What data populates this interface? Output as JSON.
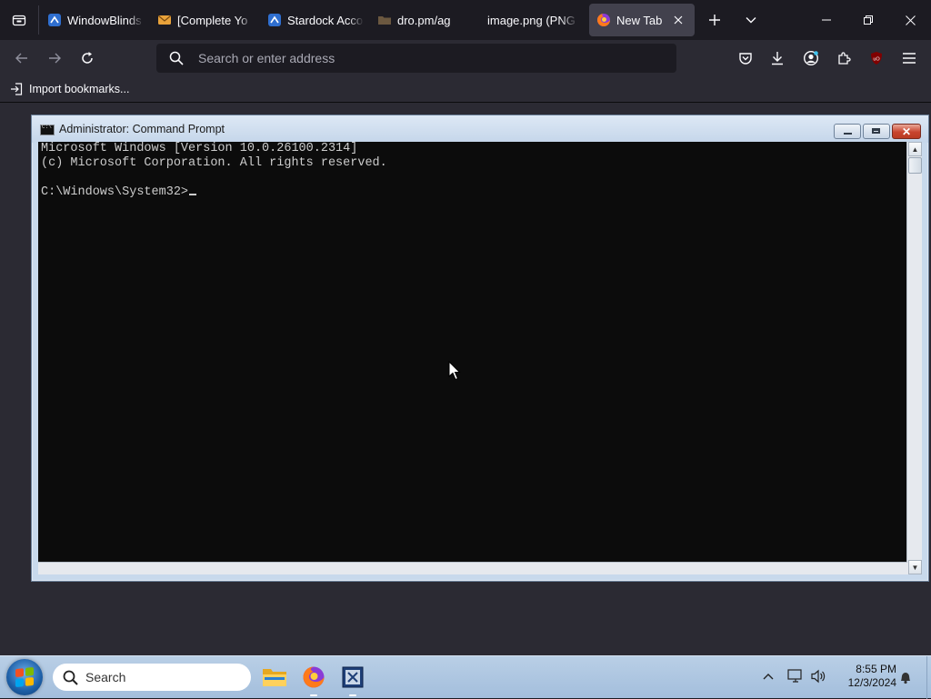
{
  "browser": {
    "tabs": [
      {
        "title": "WindowBlinds",
        "icon": "stardock-icon"
      },
      {
        "title": "[Complete Yo",
        "icon": "mail-icon"
      },
      {
        "title": "Stardock Acco",
        "icon": "stardock-icon"
      },
      {
        "title": "dro.pm/ag",
        "icon": "folder-icon"
      },
      {
        "title": "image.png (PNG I",
        "icon": "none"
      },
      {
        "title": "New Tab",
        "icon": "firefox-icon",
        "active": true
      }
    ],
    "address_bar": {
      "placeholder": "Search or enter address",
      "value": ""
    },
    "bookmarks": [
      {
        "label": "Import bookmarks...",
        "icon": "import-icon"
      }
    ],
    "colors": {
      "frame": "#1c1b22",
      "toolbar": "#2b2a33",
      "active_tab": "#42414d"
    }
  },
  "cmd_window": {
    "title": "Administrator: Command Prompt",
    "lines": [
      "Microsoft Windows [Version 10.0.26100.2314]",
      "(c) Microsoft Corporation. All rights reserved.",
      "",
      "C:\\Windows\\System32>"
    ]
  },
  "taskbar": {
    "search_label": "Search",
    "apps": [
      {
        "name": "File Explorer",
        "icon": "folder-icon"
      },
      {
        "name": "Firefox",
        "icon": "firefox-icon"
      },
      {
        "name": "Command Prompt",
        "icon": "cmd-icon"
      }
    ],
    "clock": {
      "time": "8:55 PM",
      "date": "12/3/2024"
    }
  }
}
